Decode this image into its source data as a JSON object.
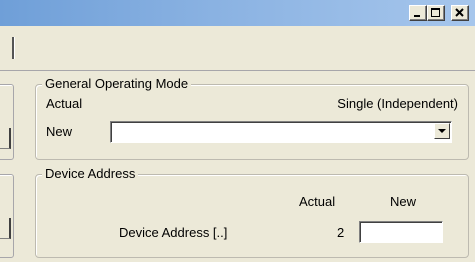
{
  "window": {
    "controls": [
      "minimize-icon",
      "maximize-icon",
      "close-icon"
    ]
  },
  "general_operating_mode": {
    "title": "General Operating Mode",
    "actual_label": "Actual",
    "actual_value": "Single (Independent)",
    "new_label": "New",
    "new_value": ""
  },
  "device_address": {
    "title": "Device Address",
    "col_actual": "Actual",
    "col_new": "New",
    "row_label": "Device Address [..]",
    "actual_value": "2",
    "new_value": ""
  }
}
